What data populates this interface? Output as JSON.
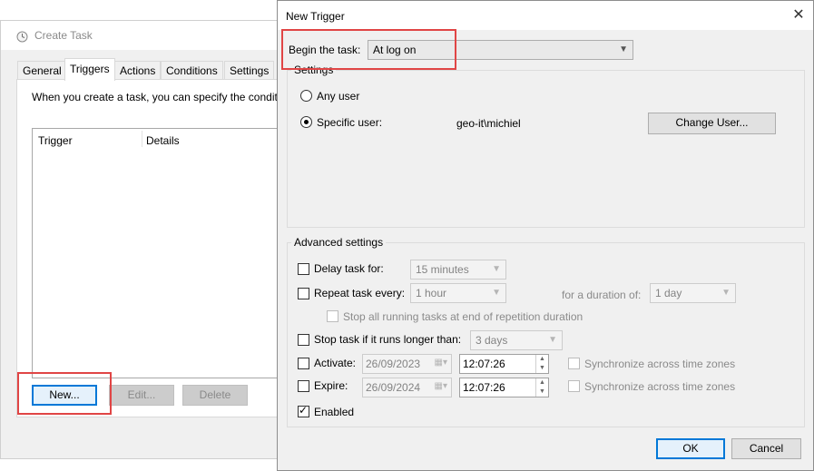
{
  "create_task": {
    "title": "Create Task",
    "tabs": [
      "General",
      "Triggers",
      "Actions",
      "Conditions",
      "Settings"
    ],
    "active_tab": "Triggers",
    "intro_text": "When you create a task, you can specify the conditi",
    "columns": [
      "Trigger",
      "Details"
    ],
    "buttons": {
      "new": "New...",
      "edit": "Edit...",
      "delete": "Delete"
    }
  },
  "new_trigger": {
    "title": "New Trigger",
    "close_glyph": "✕",
    "begin_label": "Begin the task:",
    "begin_value": "At log on",
    "settings": {
      "group_label": "Settings",
      "any_user": "Any user",
      "specific_user": "Specific user:",
      "user_value": "geo-it\\michiel",
      "change_user_button": "Change User...",
      "selected": "specific_user"
    },
    "advanced": {
      "group_label": "Advanced settings",
      "delay_label": "Delay task for:",
      "delay_value": "15 minutes",
      "repeat_label": "Repeat task every:",
      "repeat_value": "1 hour",
      "duration_label": "for a duration of:",
      "duration_value": "1 day",
      "stop_all_label": "Stop all running tasks at end of repetition duration",
      "stop_longer_label": "Stop task if it runs longer than:",
      "stop_longer_value": "3 days",
      "activate_label": "Activate:",
      "activate_date": "26/09/2023",
      "activate_time": "12:07:26",
      "expire_label": "Expire:",
      "expire_date": "26/09/2024",
      "expire_time": "12:07:26",
      "sync_label": "Synchronize across time zones",
      "enabled_label": "Enabled",
      "enabled": true
    },
    "buttons": {
      "ok": "OK",
      "cancel": "Cancel"
    }
  },
  "colors": {
    "highlight": "#e04545",
    "focus_border": "#0078d7",
    "dialog_bg": "#f0f0f0"
  }
}
